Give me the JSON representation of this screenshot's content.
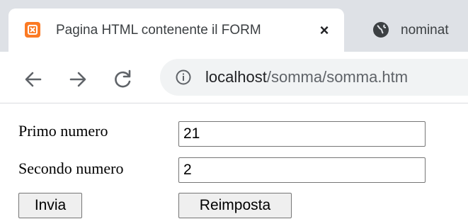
{
  "browser": {
    "tabs": [
      {
        "title": "Pagina HTML contenente il FORM",
        "favicon": "xampp-icon",
        "active": true
      },
      {
        "title": "nominat",
        "favicon": "globe-icon",
        "active": false
      }
    ],
    "tab_close_label": "×",
    "address": {
      "host": "localhost",
      "path": "/somma/somma.htm"
    },
    "accent_favicon_color": "#fb7a24"
  },
  "form": {
    "first_label": "Primo numero",
    "first_value": "21",
    "second_label": "Secondo numero",
    "second_value": "2",
    "submit_label": "Invia",
    "reset_label": "Reimposta"
  }
}
